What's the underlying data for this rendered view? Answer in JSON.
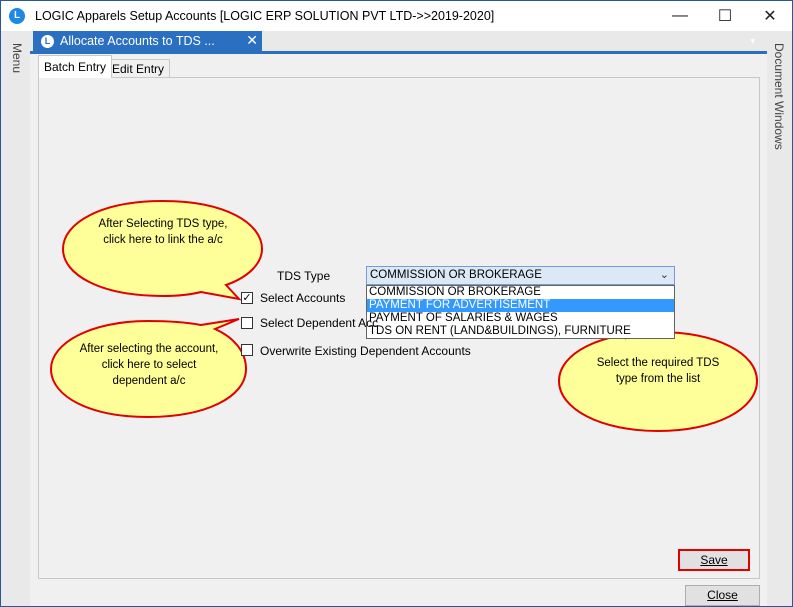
{
  "window": {
    "title": "LOGIC Apparels Setup Accounts  [LOGIC ERP SOLUTION PVT LTD->>2019-2020]",
    "logo_letter": "L",
    "minimize": "—",
    "maximize": "☐",
    "close": "✕"
  },
  "left_rail": {
    "label": "Menu"
  },
  "right_rail": {
    "label": "Document Windows"
  },
  "doc_tab": {
    "label": "Allocate Accounts to TDS ...",
    "close": "✕",
    "dropdown": "▾",
    "icon_letter": "L"
  },
  "tabs": [
    {
      "label": "Batch Entry",
      "active": true
    },
    {
      "label": "Edit Entry",
      "active": false
    }
  ],
  "form": {
    "tds_type_label": "TDS Type",
    "tds_type_value": "COMMISSION OR BROKERAGE",
    "tds_options": [
      "COMMISSION OR BROKERAGE",
      "PAYMENT FOR ADVERTISEMENT",
      "PAYMENT OF SALARIES & WAGES",
      "TDS ON RENT (LAND&BUILDINGS), FURNITURE"
    ],
    "highlighted_option_index": 1,
    "select_accounts": {
      "label": "Select Accounts",
      "checked": true
    },
    "select_dependent": {
      "label": "Select Dependent Acc",
      "checked": false
    },
    "overwrite_existing": {
      "label": "Overwrite Existing Dependent Accounts",
      "checked": false
    }
  },
  "callouts": [
    {
      "text": "After Selecting TDS type, click here to link the a/c"
    },
    {
      "text": "After selecting the account, click here to select dependent a/c"
    },
    {
      "text": "Select the required TDS type from the list"
    }
  ],
  "buttons": {
    "save": "Save",
    "close": "Close"
  },
  "colors": {
    "accent": "#2b6fc1",
    "callout_fill": "#ffff99",
    "callout_border": "#e00000",
    "highlight": "#3399ff"
  }
}
